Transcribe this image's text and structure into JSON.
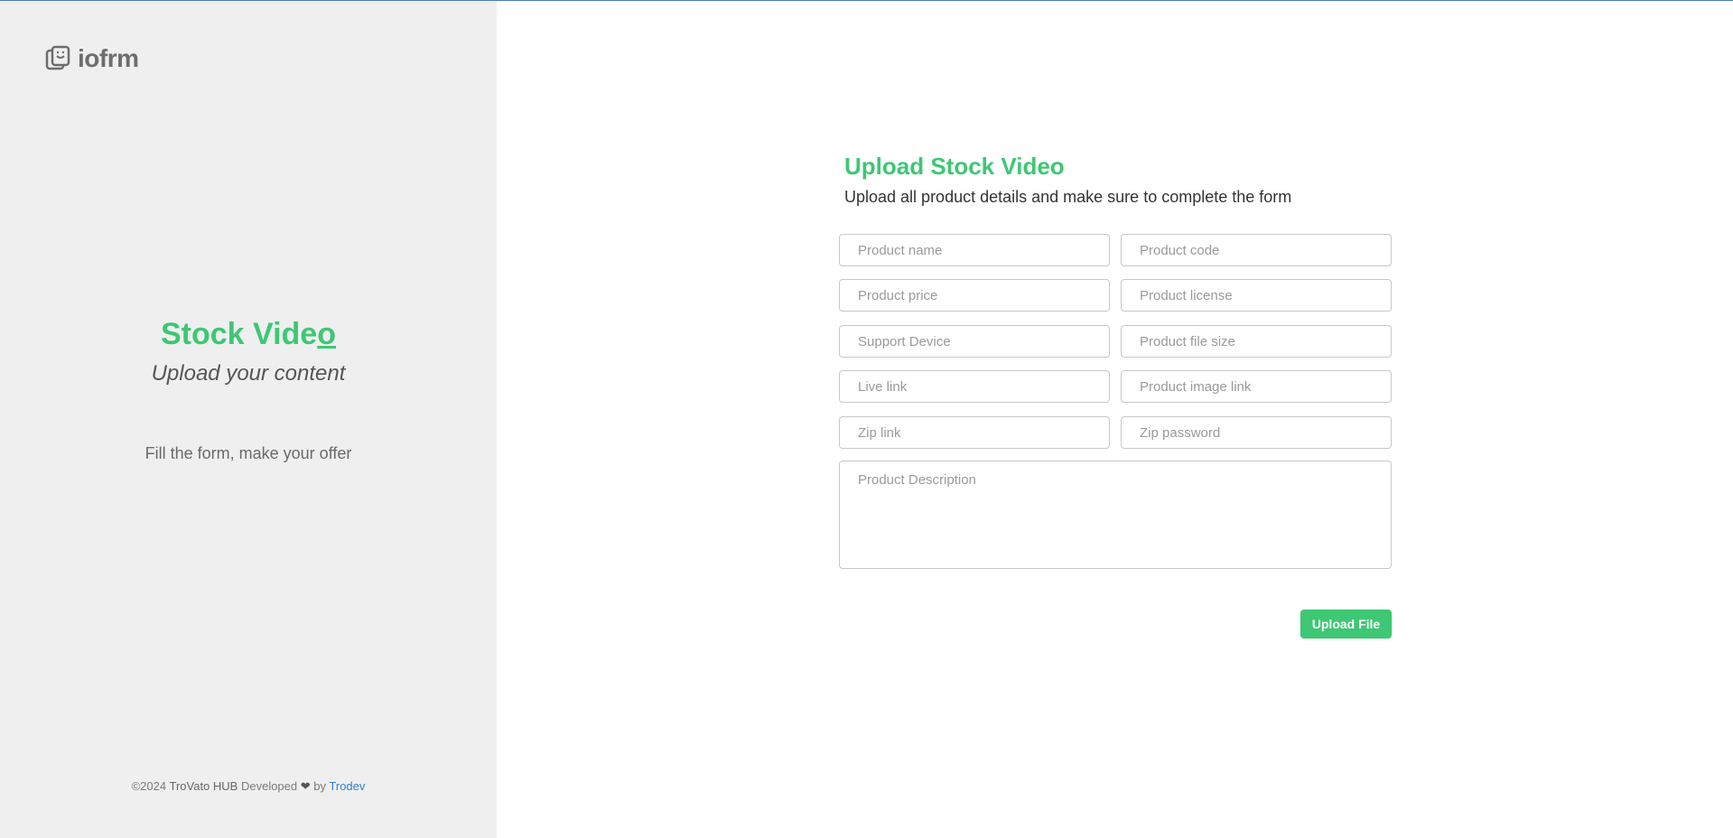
{
  "brand": {
    "logo_text": "iofrm",
    "logo_icon": "stacked-cards-icon"
  },
  "sidebar": {
    "title_main": "Stock Vide",
    "title_last_char": "o",
    "subtitle": "Upload your content",
    "tagline": "Fill the form, make your offer"
  },
  "footer": {
    "copyright": "©2024",
    "company": "TroVato HUB",
    "developed": "Developed",
    "heart_icon": "heart-icon",
    "by": "by",
    "developer": "Trodev"
  },
  "form": {
    "title": "Upload Stock Video",
    "subtitle": "Upload all product details and make sure to complete the form",
    "fields": {
      "product_name": "Product name",
      "product_code": "Product code",
      "product_price": "Product price",
      "product_license": "Product license",
      "support_device": "Support Device",
      "product_file_size": "Product file size",
      "live_link": "Live link",
      "product_image_link": "Product image link",
      "zip_link": "Zip link",
      "zip_password": "Zip password",
      "product_description": "Product Description"
    },
    "submit_label": "Upload File"
  },
  "colors": {
    "accent": "#3ec774",
    "sidebar_bg": "#efefef",
    "link": "#2f7fd6",
    "top_border": "#4a7bb7"
  }
}
